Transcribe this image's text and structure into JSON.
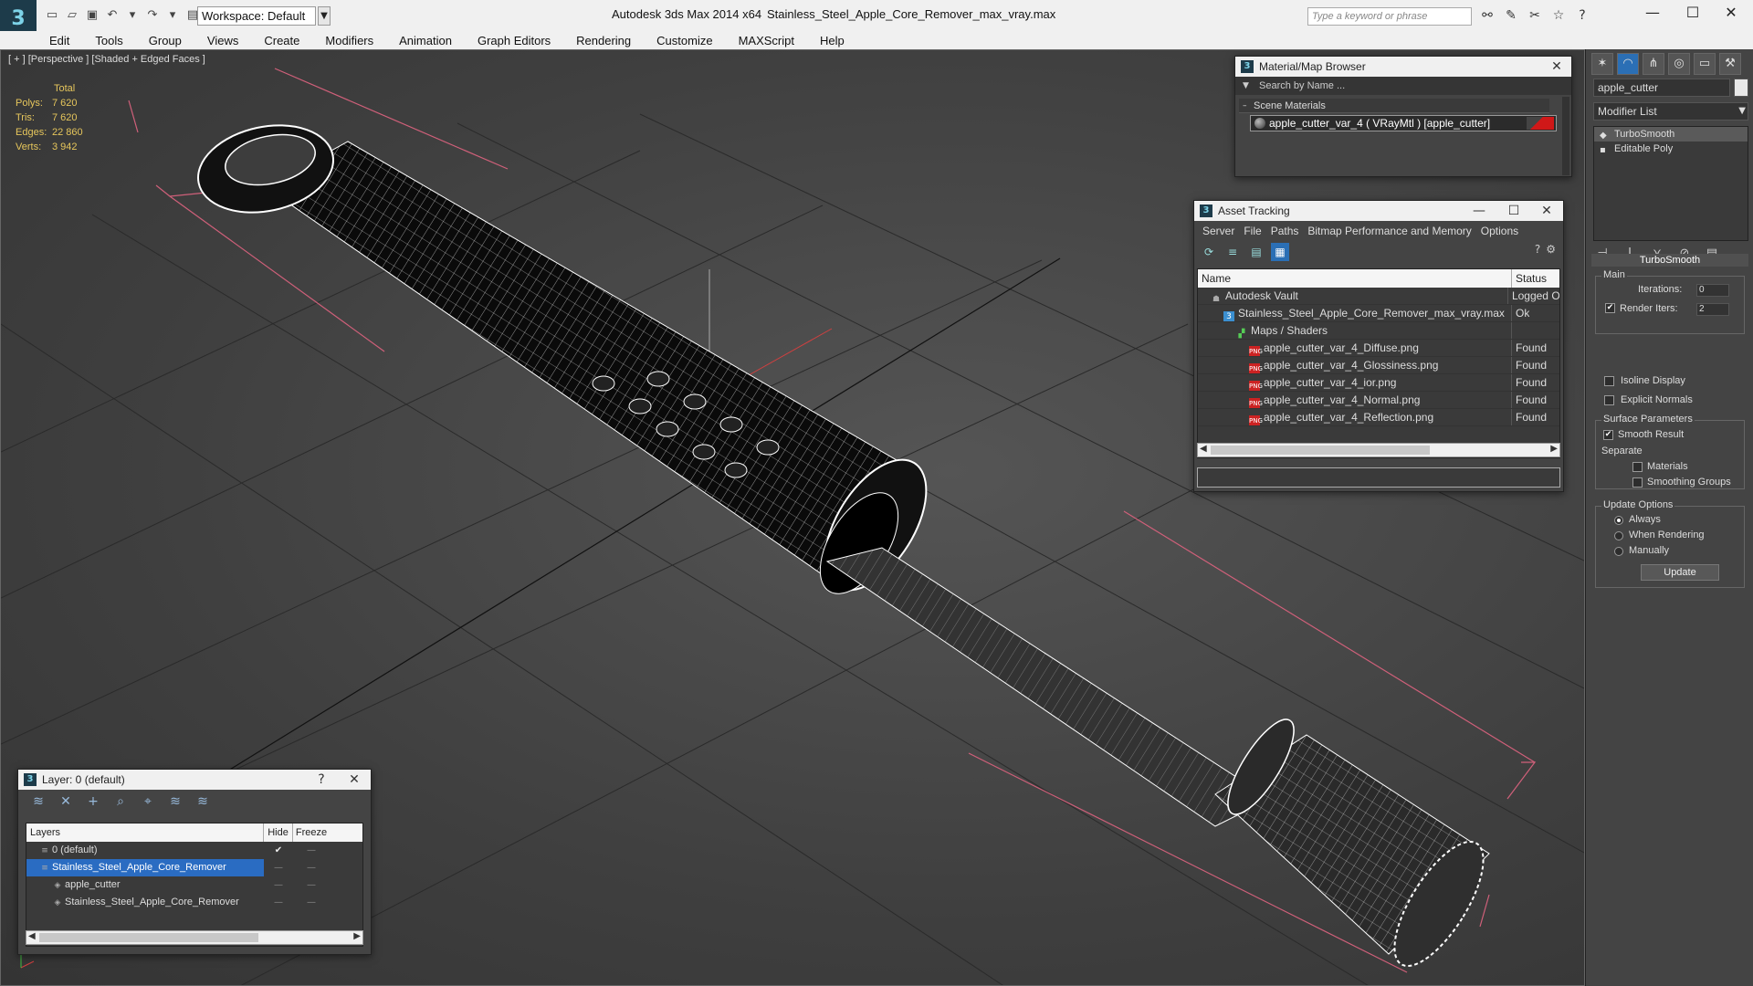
{
  "titlebar": {
    "workspace": "Workspace: Default",
    "app_title": "Autodesk 3ds Max  2014 x64",
    "file_title": "Stainless_Steel_Apple_Core_Remover_max_vray.max",
    "search_placeholder": "Type a keyword or phrase"
  },
  "menu": [
    "Edit",
    "Tools",
    "Group",
    "Views",
    "Create",
    "Modifiers",
    "Animation",
    "Graph Editors",
    "Rendering",
    "Customize",
    "MAXScript",
    "Help"
  ],
  "viewport": {
    "label": "[ + ] [Perspective ] [Shaded + Edged Faces ]",
    "stats": {
      "header": "Total",
      "rows": [
        {
          "label": "Polys:",
          "value": "7 620"
        },
        {
          "label": "Tris:",
          "value": "7 620"
        },
        {
          "label": "Edges:",
          "value": "22 860"
        },
        {
          "label": "Verts:",
          "value": "3 942"
        }
      ]
    }
  },
  "command_panel": {
    "object_name": "apple_cutter",
    "modifier_list": "Modifier List",
    "stack": [
      "TurboSmooth",
      "Editable Poly"
    ],
    "turbosmooth": {
      "title": "TurboSmooth",
      "main": "Main",
      "iterations_label": "Iterations:",
      "iterations": "0",
      "render_iters_label": "Render Iters:",
      "render_iters": "2",
      "isoline": "Isoline Display",
      "explicit": "Explicit Normals",
      "surface_params": "Surface Parameters",
      "smooth_result": "Smooth Result",
      "separate": "Separate",
      "materials": "Materials",
      "smoothing_groups": "Smoothing Groups",
      "update_options": "Update Options",
      "always": "Always",
      "when_rendering": "When Rendering",
      "manually": "Manually",
      "update": "Update"
    }
  },
  "material_browser": {
    "title": "Material/Map Browser",
    "search": "Search by Name ...",
    "section": "Scene Materials",
    "item": "apple_cutter_var_4  ( VRayMtl )  [apple_cutter]"
  },
  "asset_tracking": {
    "title": "Asset Tracking",
    "menu": [
      "Server",
      "File",
      "Paths",
      "Bitmap Performance and Memory",
      "Options"
    ],
    "columns": [
      "Name",
      "Status"
    ],
    "rows": [
      {
        "name": "Autodesk Vault",
        "status": "Logged O",
        "indent": 1,
        "icon": "vault"
      },
      {
        "name": "Stainless_Steel_Apple_Core_Remover_max_vray.max",
        "status": "Ok",
        "indent": 2,
        "icon": "max"
      },
      {
        "name": "Maps / Shaders",
        "status": "",
        "indent": 3,
        "icon": "maps"
      },
      {
        "name": "apple_cutter_var_4_Diffuse.png",
        "status": "Found",
        "indent": 4,
        "icon": "png"
      },
      {
        "name": "apple_cutter_var_4_Glossiness.png",
        "status": "Found",
        "indent": 4,
        "icon": "png"
      },
      {
        "name": "apple_cutter_var_4_ior.png",
        "status": "Found",
        "indent": 4,
        "icon": "png"
      },
      {
        "name": "apple_cutter_var_4_Normal.png",
        "status": "Found",
        "indent": 4,
        "icon": "png"
      },
      {
        "name": "apple_cutter_var_4_Reflection.png",
        "status": "Found",
        "indent": 4,
        "icon": "png"
      }
    ]
  },
  "layers": {
    "title": "Layer: 0 (default)",
    "columns": [
      "Layers",
      "Hide",
      "Freeze"
    ],
    "rows": [
      {
        "name": "0 (default)",
        "indent": 1
      },
      {
        "name": "Stainless_Steel_Apple_Core_Remover",
        "indent": 1
      },
      {
        "name": "apple_cutter",
        "indent": 2
      },
      {
        "name": "Stainless_Steel_Apple_Core_Remover",
        "indent": 2
      }
    ]
  }
}
